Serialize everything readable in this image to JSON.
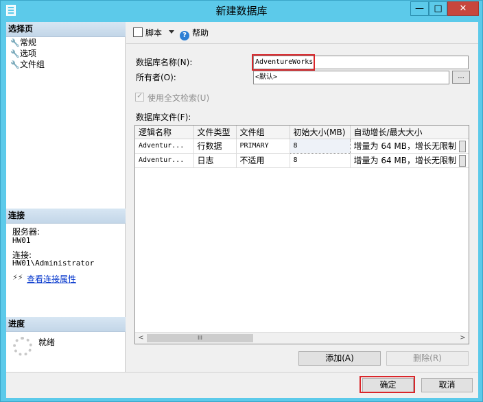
{
  "window": {
    "title": "新建数据库",
    "min": "—",
    "max": "□",
    "close": "✕"
  },
  "left": {
    "select_page_header": "选择页",
    "pages": [
      {
        "label": "常规",
        "icon": "wrench-icon"
      },
      {
        "label": "选项",
        "icon": "wrench-icon"
      },
      {
        "label": "文件组",
        "icon": "wrench-icon"
      }
    ],
    "connection_header": "连接",
    "server_label": "服务器:",
    "server_value": "HW01",
    "connection_label": "连接:",
    "connection_value": "HW01\\Administrator",
    "view_props_link": "查看连接属性",
    "progress_header": "进度",
    "status": "就绪"
  },
  "toolbar": {
    "script_label": "脚本",
    "help_label": "帮助"
  },
  "form": {
    "db_name_label": "数据库名称(N):",
    "db_name_value": "AdventureWorks",
    "owner_label": "所有者(O):",
    "owner_value": "<默认>",
    "ellipsis": "...",
    "fulltext_label": "使用全文检索(U)",
    "files_label": "数据库文件(F):"
  },
  "grid": {
    "columns": [
      "逻辑名称",
      "文件类型",
      "文件组",
      "初始大小(MB)",
      "自动增长/最大大小"
    ],
    "rows": [
      [
        "Adventur...",
        "行数据",
        "PRIMARY",
        "8",
        "增量为 64 MB，增长无限制"
      ],
      [
        "Adventur...",
        "日志",
        "不适用",
        "8",
        "增量为 64 MB，增长无限制"
      ]
    ],
    "scroll_left": "<",
    "scroll_right": ">",
    "scroll_thumb": "III"
  },
  "buttons": {
    "add": "添加(A)",
    "remove": "删除(R)",
    "ok": "确定",
    "cancel": "取消"
  },
  "colors": {
    "titlebar": "#5ccaea",
    "highlight": "#d9262a",
    "link": "#0033cc"
  }
}
